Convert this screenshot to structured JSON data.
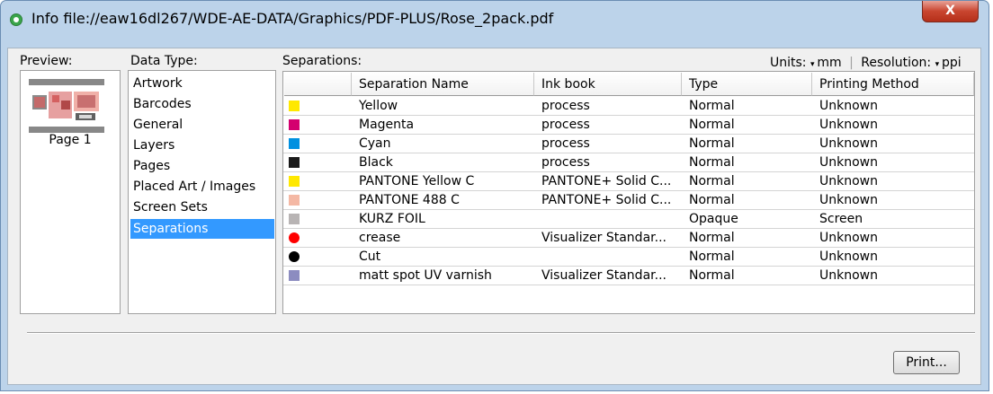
{
  "window": {
    "title": "Info file://eaw16dl267/WDE-AE-DATA/Graphics/PDF-PLUS/Rose_2pack.pdf",
    "close_label": "X"
  },
  "preview": {
    "label": "Preview:",
    "page_label": "Page 1"
  },
  "data_type": {
    "label": "Data Type:",
    "items": [
      {
        "label": "Artwork"
      },
      {
        "label": "Barcodes"
      },
      {
        "label": "General"
      },
      {
        "label": "Layers"
      },
      {
        "label": "Pages"
      },
      {
        "label": "Placed Art / Images"
      },
      {
        "label": "Screen Sets"
      },
      {
        "label": "Separations",
        "selected": true
      }
    ]
  },
  "separations": {
    "label": "Separations:",
    "units_label": "Units:",
    "units_value": "mm",
    "resolution_label": "Resolution:",
    "resolution_value": "ppi",
    "columns": [
      "",
      "Separation Name",
      "Ink book",
      "Type",
      "Printing Method"
    ],
    "rows": [
      {
        "color": "#ffe800",
        "shape": "square",
        "name": "Yellow",
        "ink_book": "process",
        "type": "Normal",
        "method": "Unknown"
      },
      {
        "color": "#d4006f",
        "shape": "square",
        "name": "Magenta",
        "ink_book": "process",
        "type": "Normal",
        "method": "Unknown"
      },
      {
        "color": "#0090e0",
        "shape": "square",
        "name": "Cyan",
        "ink_book": "process",
        "type": "Normal",
        "method": "Unknown"
      },
      {
        "color": "#1a1a1a",
        "shape": "square",
        "name": "Black",
        "ink_book": "process",
        "type": "Normal",
        "method": "Unknown"
      },
      {
        "color": "#ffe800",
        "shape": "square",
        "name": "PANTONE Yellow C",
        "ink_book": "PANTONE+ Solid C...",
        "type": "Normal",
        "method": "Unknown"
      },
      {
        "color": "#f4b8a4",
        "shape": "square",
        "name": "PANTONE 488 C",
        "ink_book": "PANTONE+ Solid C...",
        "type": "Normal",
        "method": "Unknown"
      },
      {
        "color": "#b8b4b4",
        "shape": "square",
        "name": "KURZ FOIL",
        "ink_book": "",
        "type": "Opaque",
        "method": "Screen"
      },
      {
        "color": "#ff0000",
        "shape": "round",
        "name": "crease",
        "ink_book": "Visualizer Standar...",
        "type": "Normal",
        "method": "Unknown"
      },
      {
        "color": "#000000",
        "shape": "round",
        "name": "Cut",
        "ink_book": "",
        "type": "Normal",
        "method": "Unknown"
      },
      {
        "color": "#8c8cc0",
        "shape": "square",
        "name": "matt spot UV varnish",
        "ink_book": "Visualizer Standar...",
        "type": "Normal",
        "method": "Unknown"
      }
    ]
  },
  "footer": {
    "print_label": "Print..."
  }
}
